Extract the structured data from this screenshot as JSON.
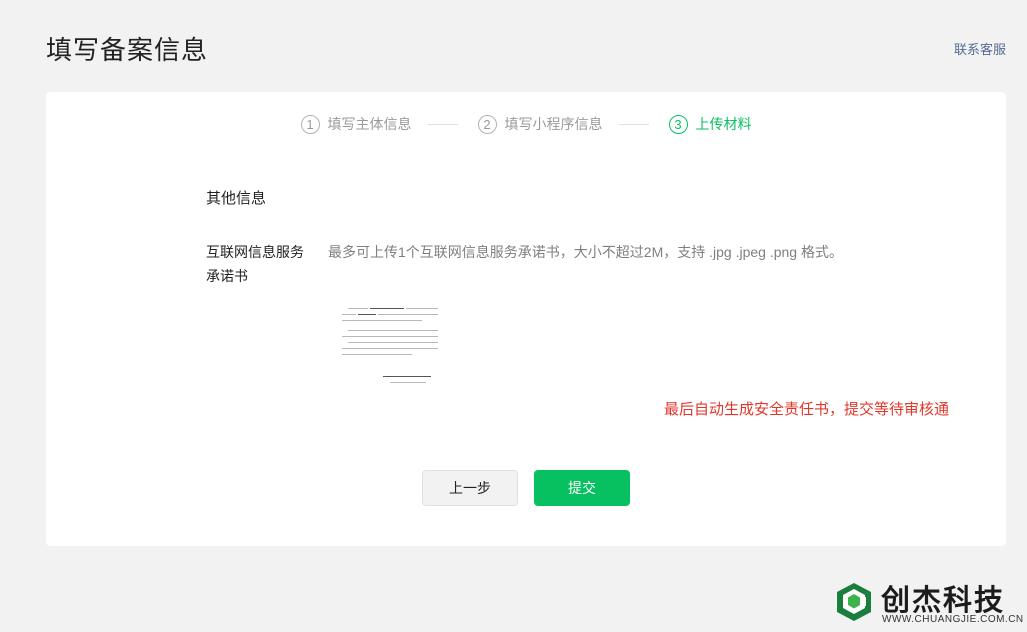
{
  "header": {
    "title": "填写备案信息",
    "help_link": "联系客服"
  },
  "steps": [
    {
      "num": "1",
      "label": "填写主体信息",
      "active": false
    },
    {
      "num": "2",
      "label": "填写小程序信息",
      "active": false
    },
    {
      "num": "3",
      "label": "上传材料",
      "active": true
    }
  ],
  "form": {
    "section_title": "其他信息",
    "field_label": "互联网信息服务承诺书",
    "field_desc": "最多可上传1个互联网信息服务承诺书，大小不超过2M，支持 .jpg .jpeg .png 格式。"
  },
  "annotation": "最后自动生成安全责任书，提交等待审核通",
  "buttons": {
    "prev": "上一步",
    "submit": "提交"
  },
  "watermark": {
    "name": "创杰科技",
    "url": "WWW.CHUANGJIE.COM.CN"
  },
  "colors": {
    "accent": "#07c160",
    "annotation": "#e0372b",
    "link": "#576b95"
  }
}
